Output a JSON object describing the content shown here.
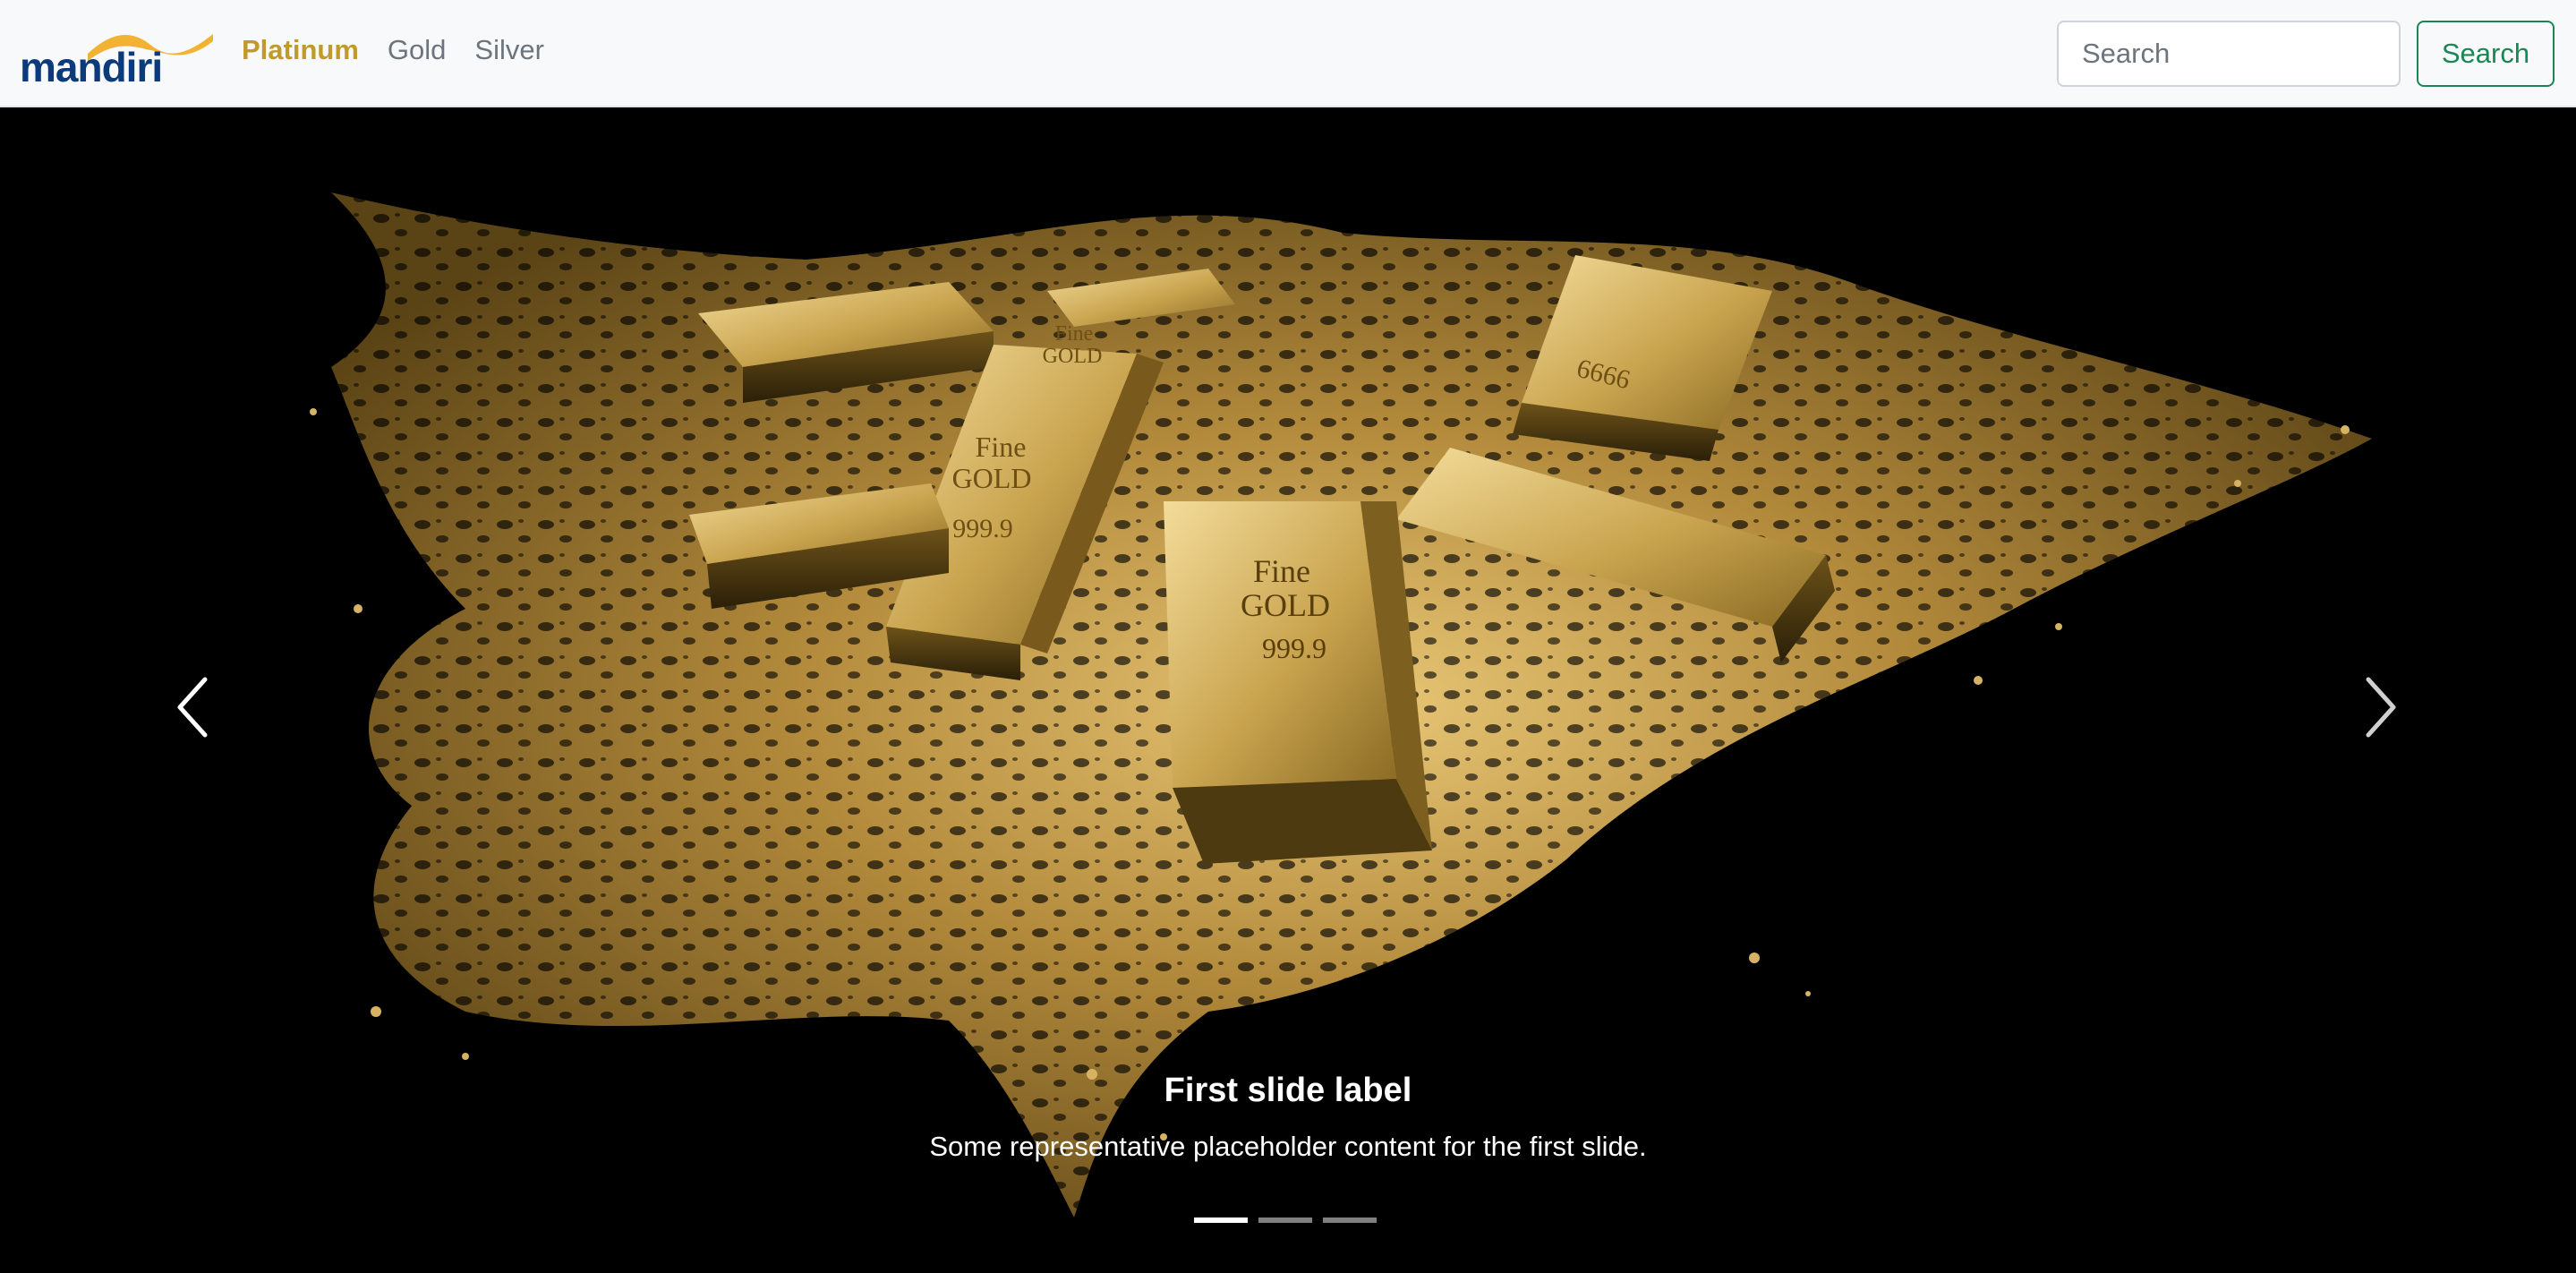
{
  "navbar": {
    "brand": {
      "text": "mandiri",
      "accent_color": "#f2b233",
      "text_color": "#0c3b7c"
    },
    "links": [
      {
        "label": "Platinum",
        "active": true
      },
      {
        "label": "Gold",
        "active": false
      },
      {
        "label": "Silver",
        "active": false
      }
    ],
    "active_color": "#c09a2d"
  },
  "search": {
    "placeholder": "Search",
    "value": "",
    "button_label": "Search",
    "button_color": "#198754"
  },
  "carousel": {
    "slide_count": 3,
    "active_slide": 1,
    "image": {
      "bar_labels": [
        {
          "line1": "Fine",
          "line2": "GOLD",
          "line3": "999.9"
        },
        {
          "line1": "Fine",
          "line2": "GOLD",
          "line3": "999.9"
        },
        {
          "line1": "Fine",
          "line2": "GOLD",
          "line3": ""
        },
        {
          "line1": "6666",
          "line2": "",
          "line3": ""
        }
      ]
    },
    "caption": {
      "title": "First slide label",
      "text": "Some representative placeholder content for the first slide."
    },
    "prev_icon": "chevron-left-icon",
    "next_icon": "chevron-right-icon"
  }
}
